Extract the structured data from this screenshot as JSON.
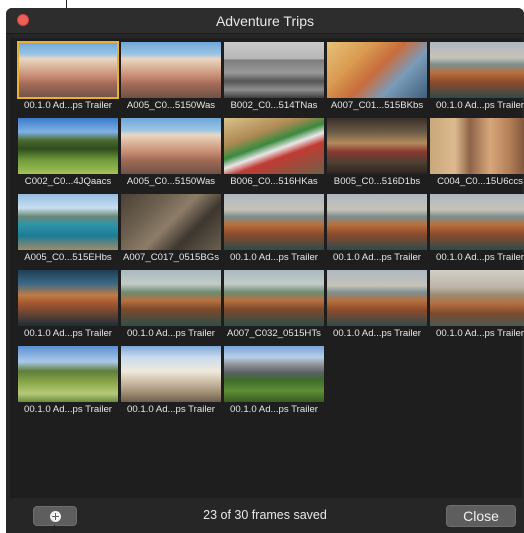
{
  "window": {
    "title": "Adventure Trips"
  },
  "frames": [
    {
      "caption": "00.1.0 Ad...ps Trailer",
      "scene": "village",
      "selected": true
    },
    {
      "caption": "A005_C0...5150Was",
      "scene": "village",
      "selected": false
    },
    {
      "caption": "B002_C0...514TNas",
      "scene": "checker",
      "selected": false
    },
    {
      "caption": "A007_C01...515BKbs",
      "scene": "houses",
      "selected": false
    },
    {
      "caption": "00.1.0 Ad...ps Trailer",
      "scene": "cliff",
      "selected": false
    },
    {
      "caption": "C002_C0...4JQaacs",
      "scene": "cypress",
      "selected": false
    },
    {
      "caption": "A005_C0...5150Was",
      "scene": "village",
      "selected": false
    },
    {
      "caption": "B006_C0...516HKas",
      "scene": "flag",
      "selected": false
    },
    {
      "caption": "B005_C0...516D1bs",
      "scene": "alley",
      "selected": false
    },
    {
      "caption": "C004_C0...15U6ccs",
      "scene": "facade",
      "selected": false
    },
    {
      "caption": "A005_C0...515EHbs",
      "scene": "bay",
      "selected": false
    },
    {
      "caption": "A007_C017_0515BGs",
      "scene": "rocks",
      "selected": false
    },
    {
      "caption": "00.1.0 Ad...ps Trailer",
      "scene": "cliff",
      "selected": false
    },
    {
      "caption": "00.1.0 Ad...ps Trailer",
      "scene": "cliff",
      "selected": false
    },
    {
      "caption": "00.1.0 Ad...ps Trailer",
      "scene": "cliff",
      "selected": false
    },
    {
      "caption": "00.1.0 Ad...ps Trailer",
      "scene": "cliff-dark",
      "selected": false
    },
    {
      "caption": "00.1.0 Ad...ps Trailer",
      "scene": "cliff-green",
      "selected": false
    },
    {
      "caption": "A007_C032_0515HTs",
      "scene": "cliff-green",
      "selected": false
    },
    {
      "caption": "00.1.0 Ad...ps Trailer",
      "scene": "cliff",
      "selected": false
    },
    {
      "caption": "00.1.0 Ad...ps Trailer",
      "scene": "cliff-haze",
      "selected": false
    },
    {
      "caption": "00.1.0 Ad...ps Trailer",
      "scene": "cypress-field",
      "selected": false
    },
    {
      "caption": "00.1.0 Ad...ps Trailer",
      "scene": "tower",
      "selected": false
    },
    {
      "caption": "00.1.0 Ad...ps Trailer",
      "scene": "mountains",
      "selected": false
    }
  ],
  "footer": {
    "status": "23 of 30 frames saved",
    "close_label": "Close",
    "add_icon": "plus-circle-icon"
  },
  "colors": {
    "window_bg": "#262626",
    "panel_bg": "#1e1e1e",
    "selection": "#e8b133",
    "close_dot": "#ec5f5a"
  }
}
